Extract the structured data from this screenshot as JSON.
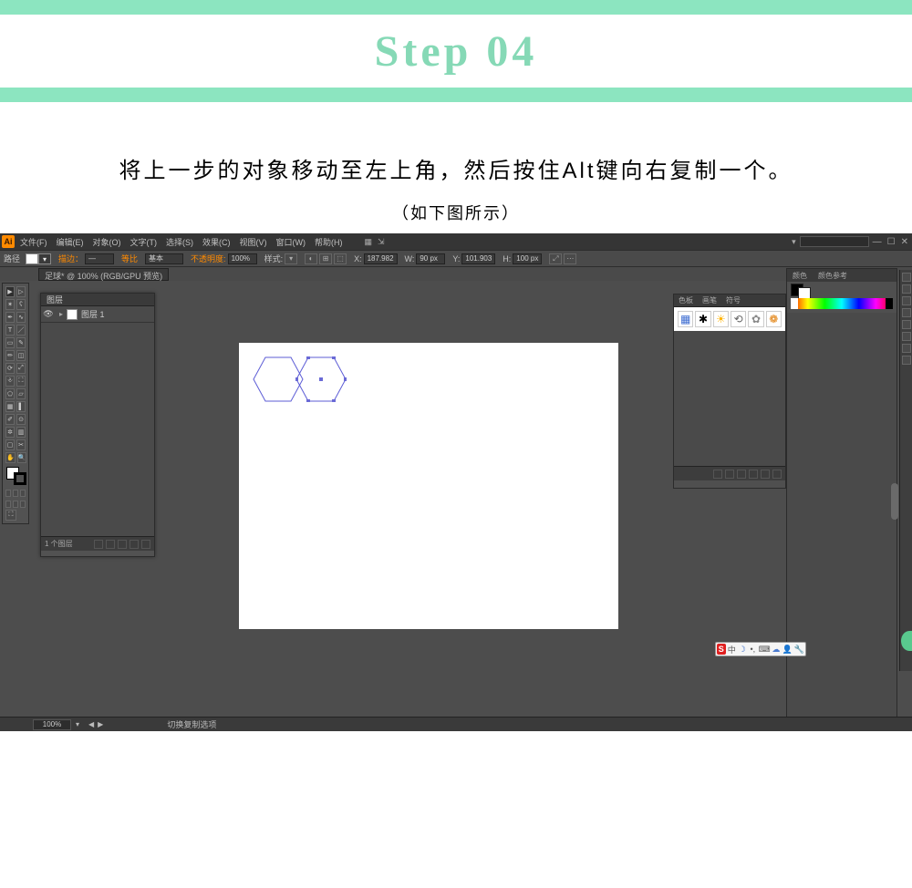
{
  "step": {
    "label": "Step 04"
  },
  "instruction": {
    "main": "将上一步的对象移动至左上角，然后按住Alt键向右复制一个。",
    "sub": "（如下图所示）"
  },
  "menubar": {
    "logo": "Ai",
    "items": [
      {
        "label": "文件(F)"
      },
      {
        "label": "编辑(E)"
      },
      {
        "label": "对象(O)"
      },
      {
        "label": "文字(T)"
      },
      {
        "label": "选择(S)"
      },
      {
        "label": "效果(C)"
      },
      {
        "label": "视图(V)"
      },
      {
        "label": "窗口(W)"
      },
      {
        "label": "帮助(H)"
      }
    ],
    "win_min": "—",
    "win_max": "☐",
    "win_close": "✕"
  },
  "ctrlbar": {
    "left": "路径",
    "stroke_lbl": "描边：",
    "stroke_dash": "—",
    "brush_lbl": "基本",
    "opacity_lbl": "不透明度:",
    "opacity_val": "100%",
    "style_lbl": "样式:",
    "x_lbl": "X:",
    "x_val": "187.982",
    "w_lbl": "W:",
    "w_val": "90 px",
    "y_lbl": "Y:",
    "y_val": "101.903",
    "h_lbl": "H:",
    "h_val": "100 px",
    "equal": "等比"
  },
  "doc_tab": "足球* @ 100% (RGB/GPU 预览)",
  "layers_panel": {
    "tab": "图层",
    "layer_name": "图层 1",
    "footer_label": "1 个图层"
  },
  "assets_panel": {
    "tabs": [
      "色板",
      "画笔",
      "符号"
    ],
    "sym_icons": [
      "▦",
      "✱",
      "☀",
      "⟲",
      "✿",
      "❁"
    ]
  },
  "color_panel": {
    "tabs": [
      "颜色",
      "颜色参考"
    ]
  },
  "status": {
    "zoom": "100%",
    "tool": "切换复制选项"
  },
  "ime": {
    "s": "S",
    "cn": "中",
    "moon": "☽",
    "dot": "•,",
    "kb": "⌨",
    "cloud": "☁",
    "usr": "👤",
    "wr": "🔧"
  }
}
